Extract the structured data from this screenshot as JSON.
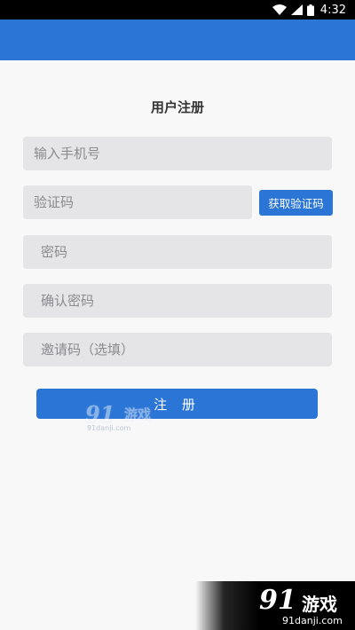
{
  "status_bar": {
    "time": "4:32",
    "icons": [
      "wifi-icon",
      "cellular-signal-icon",
      "battery-icon"
    ]
  },
  "colors": {
    "primary": "#2a75d6",
    "field_background": "#e5e5e8",
    "page_background": "#f8f8f8"
  },
  "title": "用户注册",
  "form": {
    "phone_placeholder": "输入手机号",
    "code_placeholder": "验证码",
    "get_code_label": "获取验证码",
    "password_placeholder": "密码",
    "confirm_password_placeholder": "确认密码",
    "invite_code_placeholder": "邀请码（选填）",
    "submit_label": "注 册"
  },
  "watermark": {
    "logo_script": "91",
    "logo_text": "游戏",
    "url": "91danji.com"
  }
}
